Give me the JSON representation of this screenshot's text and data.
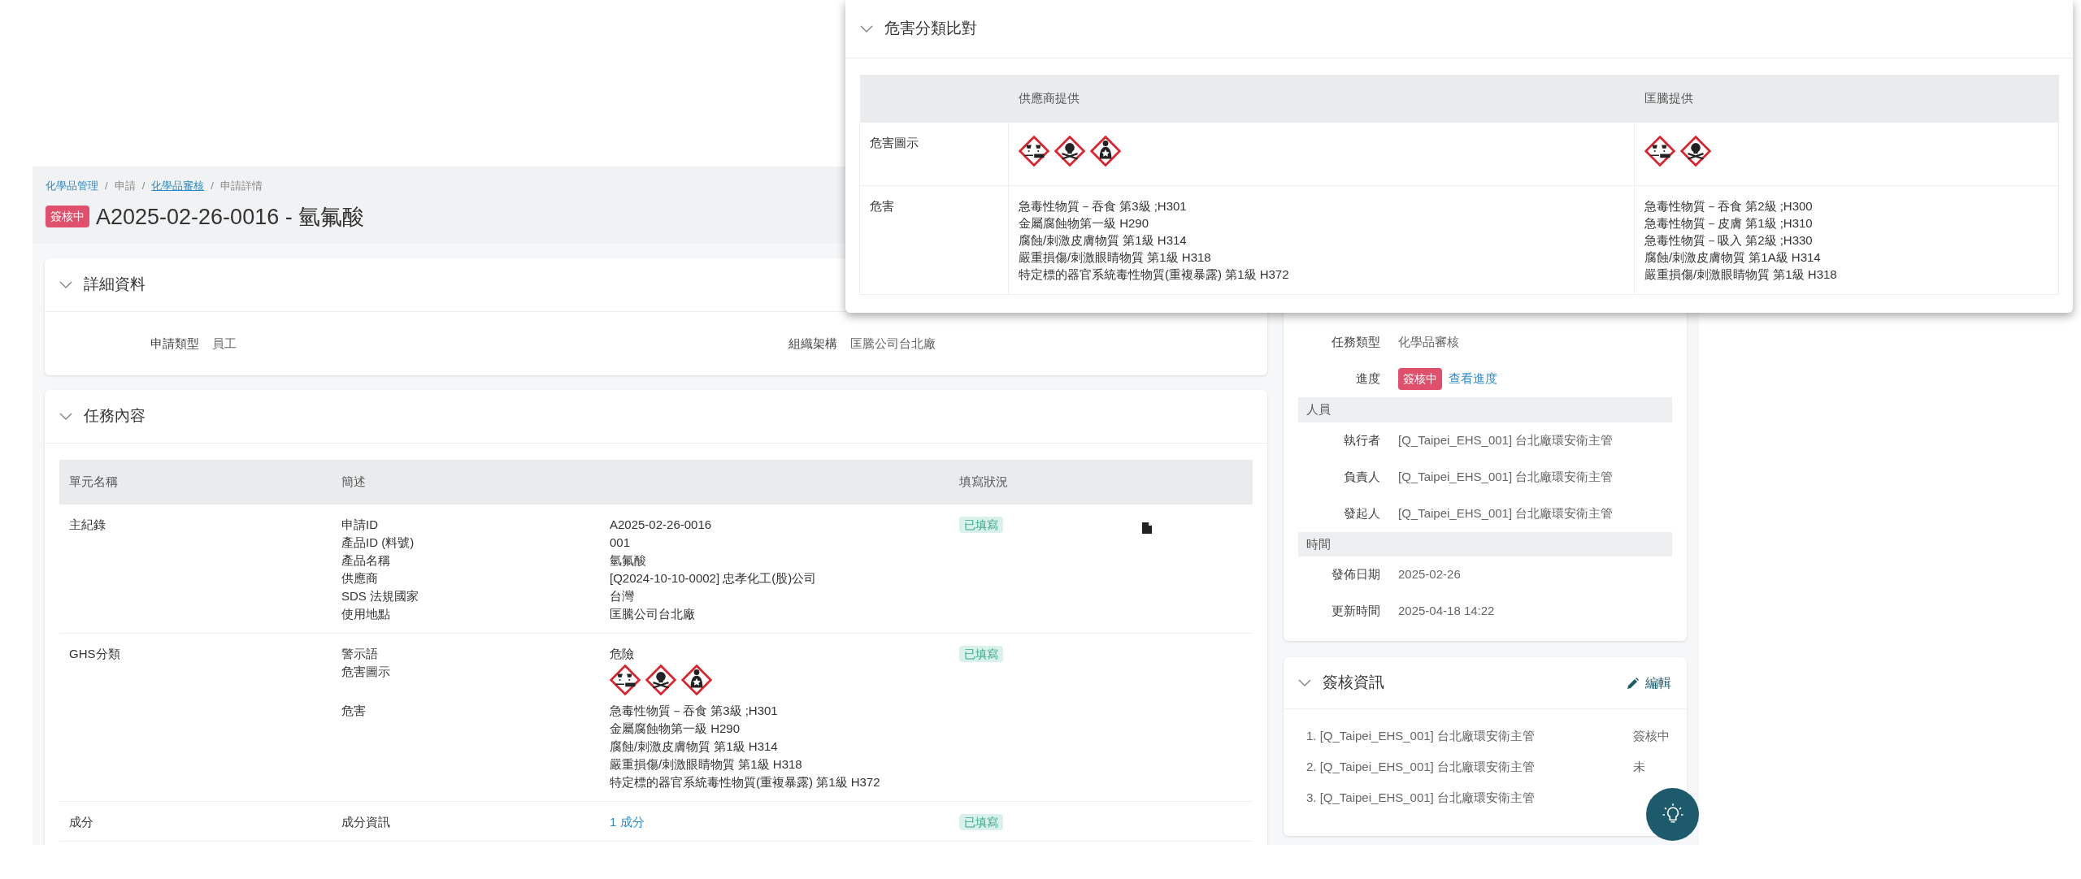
{
  "breadcrumb": [
    {
      "label": "化學品管理",
      "link": true
    },
    {
      "separator_before": "/",
      "label": "申請",
      "link": false
    },
    {
      "separator_before": "/",
      "label": "化學品審核",
      "link": true
    },
    {
      "separator_before": "/",
      "label": "申請詳情",
      "link": false
    }
  ],
  "title": {
    "badge": "簽核中",
    "text": "A2025-02-26-0016 - 氫氟酸"
  },
  "details_card": {
    "title": "詳細資料",
    "fields": [
      {
        "label": "申請類型",
        "value": "員工"
      },
      {
        "label": "組織架構",
        "value": "匡騰公司台北廠"
      }
    ]
  },
  "task_card": {
    "title": "任務內容",
    "columns": [
      "單元名稱",
      "簡述",
      "填寫狀況"
    ],
    "rows": [
      {
        "name": "主紀錄",
        "status": "已填寫",
        "has_file": true,
        "items": [
          {
            "label": "申請ID",
            "kind": "text",
            "value": "A2025-02-26-0016"
          },
          {
            "label": "產品ID (料號)",
            "kind": "text",
            "value": "001"
          },
          {
            "label": "產品名稱",
            "kind": "text",
            "value": "氫氟酸"
          },
          {
            "label": "供應商",
            "kind": "text",
            "value": "[Q2024-10-10-0002] 忠孝化工(股)公司"
          },
          {
            "label": "SDS 法規國家",
            "kind": "text",
            "value": "台灣"
          },
          {
            "label": "使用地點",
            "kind": "text",
            "value": "匡騰公司台北廠"
          }
        ]
      },
      {
        "name": "GHS分類",
        "status": "已填寫",
        "has_file": false,
        "items": [
          {
            "label": "警示語",
            "kind": "text",
            "value": "危險"
          },
          {
            "label": "危害圖示",
            "kind": "pictograms",
            "pictograms": [
              {
                "kind": "corrosion"
              },
              {
                "kind": "skull"
              },
              {
                "kind": "health"
              }
            ]
          },
          {
            "label": "危害",
            "kind": "lines",
            "lines": [
              "急毒性物質－吞食 第3級 ;H301",
              "金屬腐蝕物第一級 H290",
              "腐蝕/刺激皮膚物質 第1級 H314",
              "嚴重損傷/刺激眼睛物質 第1級 H318",
              "特定標的器官系統毒性物質(重複暴露) 第1級 H372"
            ]
          }
        ]
      },
      {
        "name": "成分",
        "status": "已填寫",
        "has_file": false,
        "items": [
          {
            "label": "成分資訊",
            "kind": "link",
            "value": "1 成分"
          }
        ]
      }
    ]
  },
  "info_card": {
    "fields": [
      {
        "label": "任務類型",
        "value": "化學品審核"
      },
      {
        "label": "進度",
        "badge": "簽核中",
        "link": "查看進度"
      }
    ],
    "sections": [
      {
        "title": "人員",
        "fields": [
          {
            "label": "執行者",
            "value": "[Q_Taipei_EHS_001] 台北廠環安衛主管"
          },
          {
            "label": "負責人",
            "value": "[Q_Taipei_EHS_001] 台北廠環安衛主管"
          },
          {
            "label": "發起人",
            "value": "[Q_Taipei_EHS_001] 台北廠環安衛主管"
          }
        ]
      },
      {
        "title": "時間",
        "fields": [
          {
            "label": "發佈日期",
            "value": "2025-02-26"
          },
          {
            "label": "更新時間",
            "value": "2025-04-18 14:22"
          }
        ]
      }
    ]
  },
  "approval_card": {
    "title": "簽核資訊",
    "edit_label": "編輯",
    "entries": [
      {
        "text": "1. [Q_Taipei_EHS_001] 台北廠環安衛主管",
        "status": "簽核中"
      },
      {
        "text": "2. [Q_Taipei_EHS_001] 台北廠環安衛主管",
        "status": "未"
      },
      {
        "text": "3. [Q_Taipei_EHS_001] 台北廠環安衛主管"
      }
    ]
  },
  "hazard_popup": {
    "title": "危害分類比對",
    "columns": [
      "供應商提供",
      "匡騰提供"
    ],
    "rows": [
      {
        "label": "危害圖示",
        "kind": "pictograms",
        "cells": [
          [
            {
              "kind": "corrosion"
            },
            {
              "kind": "skull"
            },
            {
              "kind": "health"
            }
          ],
          [
            {
              "kind": "corrosion"
            },
            {
              "kind": "skull"
            }
          ]
        ]
      },
      {
        "label": "危害",
        "kind": "lines",
        "cells": [
          [
            "急毒性物質－吞食 第3級 ;H301",
            "金屬腐蝕物第一級 H290",
            "腐蝕/刺激皮膚物質 第1級 H314",
            "嚴重損傷/刺激眼睛物質 第1級 H318",
            "特定標的器官系統毒性物質(重複暴露) 第1級 H372"
          ],
          [
            "急毒性物質－吞食 第2級 ;H300",
            "急毒性物質－皮膚 第1級 ;H310",
            "急毒性物質－吸入 第2級 ;H330",
            "腐蝕/刺激皮膚物質 第1A級 H314",
            "嚴重損傷/刺激眼睛物質 第1級 H318"
          ]
        ]
      }
    ]
  }
}
